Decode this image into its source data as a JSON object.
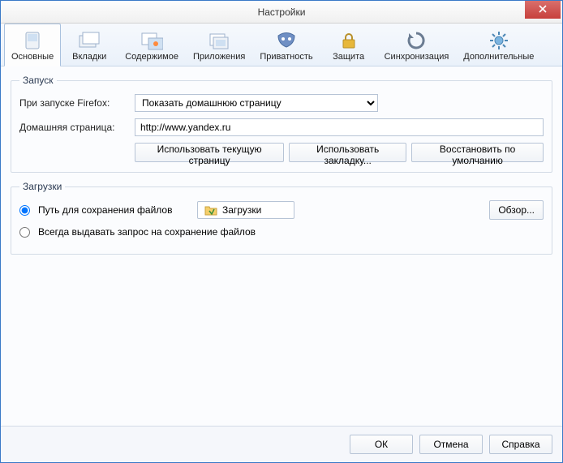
{
  "window": {
    "title": "Настройки"
  },
  "tabs": [
    {
      "label": "Основные"
    },
    {
      "label": "Вкладки"
    },
    {
      "label": "Содержимое"
    },
    {
      "label": "Приложения"
    },
    {
      "label": "Приватность"
    },
    {
      "label": "Защита"
    },
    {
      "label": "Синхронизация"
    },
    {
      "label": "Дополнительные"
    }
  ],
  "startup": {
    "legend": "Запуск",
    "on_startup_label": "При запуске Firefox:",
    "on_startup_value": "Показать домашнюю страницу",
    "homepage_label": "Домашняя страница:",
    "homepage_value": "http://www.yandex.ru",
    "use_current": "Использовать текущую страницу",
    "use_bookmark": "Использовать закладку...",
    "restore_default": "Восстановить по умолчанию"
  },
  "downloads": {
    "legend": "Загрузки",
    "save_to_label": "Путь для сохранения файлов",
    "save_to_path": "Загрузки",
    "browse": "Обзор...",
    "always_ask_label": "Всегда выдавать запрос на сохранение файлов"
  },
  "footer": {
    "ok": "ОК",
    "cancel": "Отмена",
    "help": "Справка"
  }
}
